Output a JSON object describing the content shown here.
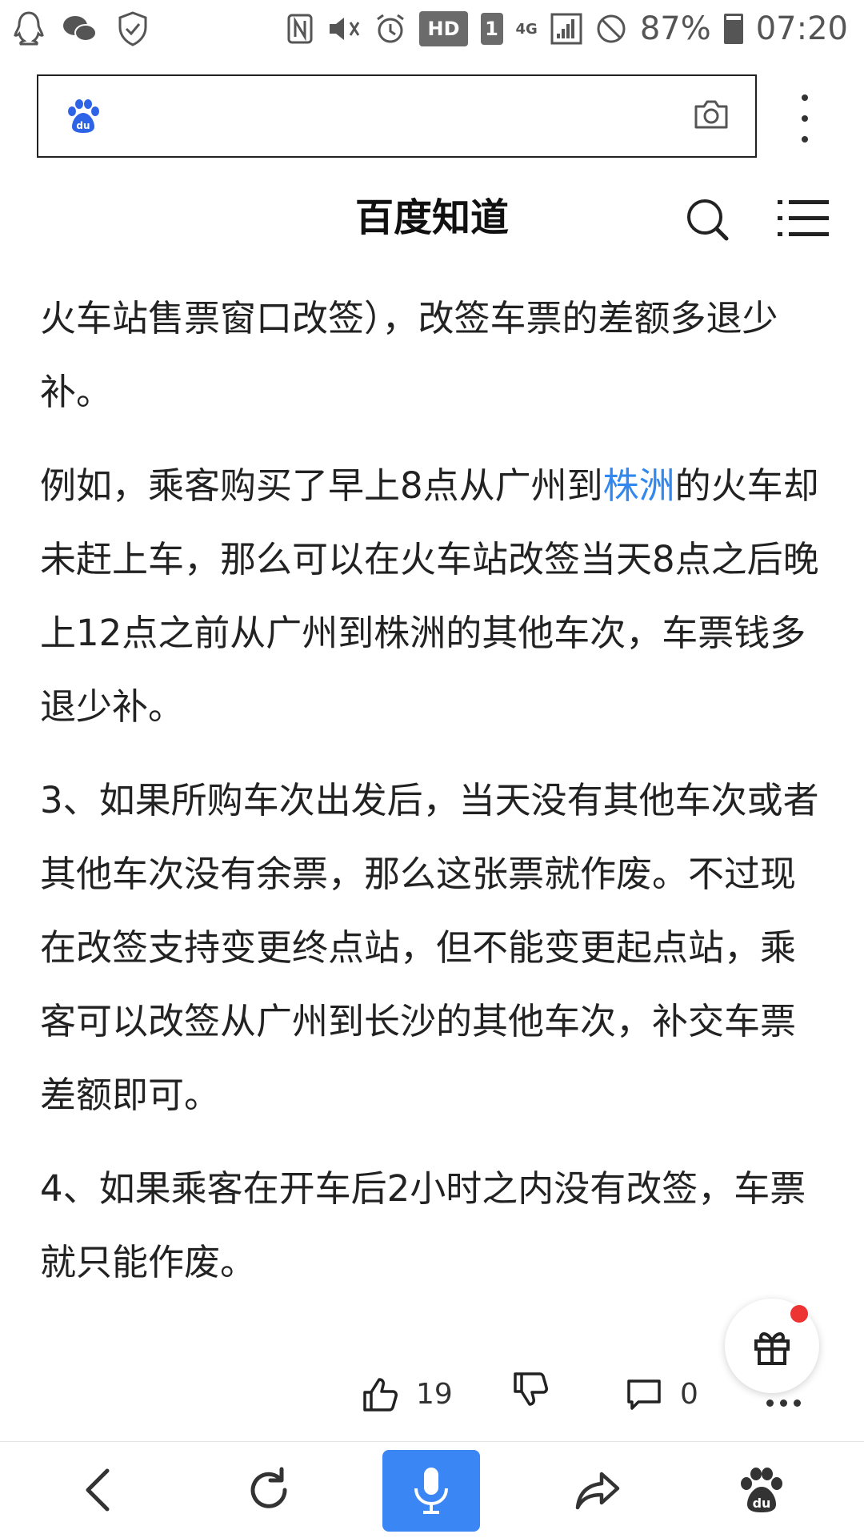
{
  "status_bar": {
    "battery_percent": "87%",
    "time": "07:20",
    "hd_label": "HD",
    "sim_label": "1",
    "network_label": "4G",
    "left_icons": [
      "qq-icon",
      "wechat-icon",
      "shield-icon"
    ],
    "right_icons": [
      "nfc-icon",
      "mute-icon",
      "alarm-icon",
      "signal-icon",
      "do-not-disturb-icon",
      "battery-icon"
    ]
  },
  "browser": {
    "search_value": "",
    "menu_icon": "kebab-menu-icon"
  },
  "header": {
    "title": "百度知道"
  },
  "article": {
    "p1": "火车站售票窗口改签），改签车票的差额多退少补。",
    "p2_before": "例如，乘客购买了早上8点从广州到",
    "p2_link": "株洲",
    "p2_after": "的火车却未赶上车，那么可以在火车站改签当天8点之后晚上12点之前从广州到株洲的其他车次，车票钱多退少补。",
    "p3": "3、如果所购车次出发后，当天没有其他车次或者其他车次没有余票，那么这张票就作废。不过现在改签支持变更终点站，但不能变更起点站，乘客可以改签从广州到长沙的其他车次，补交车票差额即可。",
    "p4": "4、如果乘客在开车后2小时之内没有改签，车票就只能作废。"
  },
  "actions": {
    "like_count": "19",
    "comment_count": "0"
  },
  "colors": {
    "link": "#3388ee",
    "voice_button": "#3a86f4",
    "notification_dot": "#ee3333"
  }
}
